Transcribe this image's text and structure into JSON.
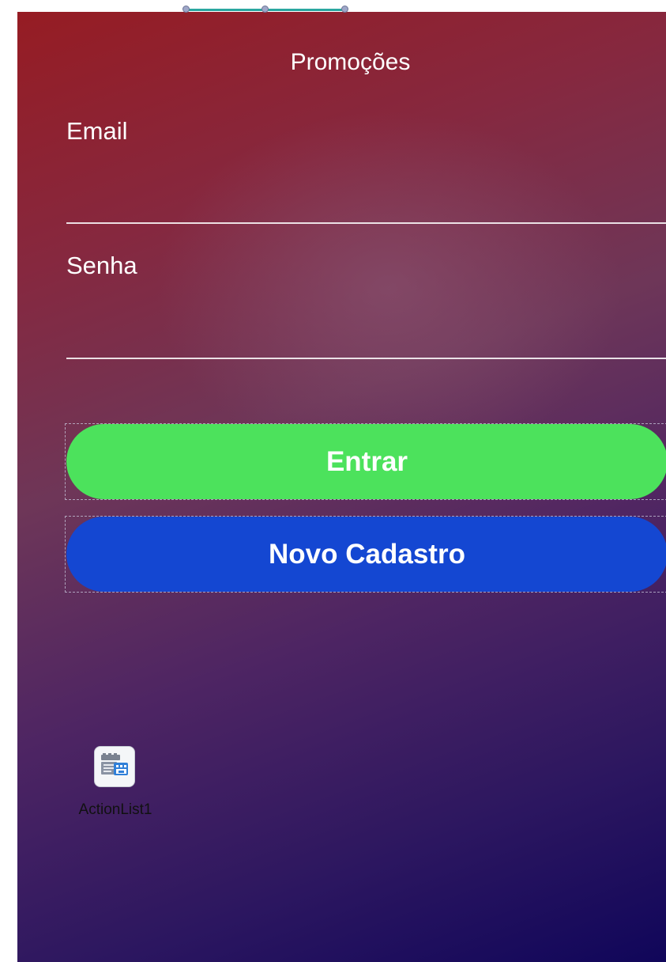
{
  "form": {
    "title": "Promoções"
  },
  "email": {
    "label": "Email",
    "value": ""
  },
  "senha": {
    "label": "Senha",
    "value": ""
  },
  "buttons": {
    "entrar": "Entrar",
    "novo_cadastro": "Novo Cadastro"
  },
  "components": {
    "action_list": {
      "label": "ActionList1",
      "icon": "action-list-icon"
    }
  },
  "colors": {
    "entrar_bg": "#4ce25c",
    "novo_cadastro_bg": "#1447d2",
    "gradient_top": "#961c23",
    "gradient_bottom": "#10065a"
  }
}
